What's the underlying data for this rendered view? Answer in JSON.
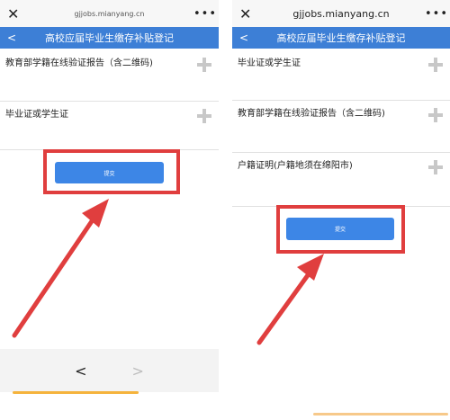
{
  "left_phone": {
    "browser": {
      "close_glyph": "✕",
      "url": "gjjobs.mianyang.cn",
      "menu_glyph": "•••"
    },
    "header": {
      "back_glyph": "<",
      "title": "高校应届毕业生缴存补贴登记"
    },
    "fields": [
      {
        "label": "教育部学籍在线验证报告（含二维码)"
      },
      {
        "label": "毕业证或学生证"
      }
    ],
    "submit_label": "提交",
    "nav": {
      "prev_glyph": "<",
      "next_glyph": ">"
    }
  },
  "right_phone": {
    "browser": {
      "close_glyph": "✕",
      "url": "gjjobs.mianyang.cn",
      "menu_glyph": "•••"
    },
    "header": {
      "back_glyph": "<",
      "title": "高校应届毕业生缴存补贴登记"
    },
    "fields": [
      {
        "label": "毕业证或学生证"
      },
      {
        "label": "教育部学籍在线验证报告（含二维码)"
      },
      {
        "label": "户籍证明(户籍地须在绵阳市)"
      }
    ],
    "submit_label": "提交"
  },
  "colors": {
    "header_blue": "#3d7fd6",
    "button_blue": "#3d86e6",
    "highlight_red": "#e03e3e",
    "home_indicator_left": "#f5b33c",
    "home_indicator_right": "#f7c98a"
  }
}
